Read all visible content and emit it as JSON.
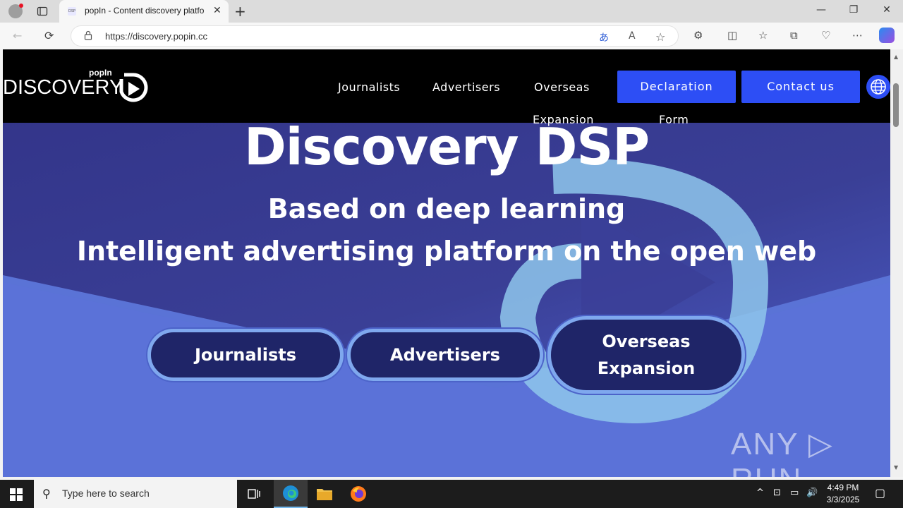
{
  "browser": {
    "tab_title": "popIn - Content discovery platfo",
    "favicon_text": "DSP",
    "url": "https://discovery.popin.cc",
    "close_glyph": "✕",
    "new_tab_glyph": "+",
    "minimize_glyph": "—",
    "restore_glyph": "❐",
    "window_close_glyph": "✕"
  },
  "site": {
    "logo_small": "popIn",
    "logo_word": "DISCOVERY",
    "nav": {
      "journalists": "Journalists",
      "advertisers": "Advertisers",
      "overseas_line1": "Overseas",
      "overseas_line2": "Expansion"
    },
    "declaration_line1": "Declaration",
    "declaration_line2": "Form",
    "contact": "Contact us"
  },
  "hero": {
    "title": "Discovery DSP",
    "subtitle1": "Based on deep learning",
    "subtitle2": "Intelligent advertising platform on the open web",
    "cta_journalists": "Journalists",
    "cta_advertisers": "Advertisers",
    "cta_overseas_line1": "Overseas",
    "cta_overseas_line2": "Expansion"
  },
  "watermark": "ANY ▷ RUN",
  "taskbar": {
    "search_placeholder": "Type here to search",
    "time": "4:49 PM",
    "date": "3/3/2025"
  },
  "colors": {
    "header_bg": "#000000",
    "button_blue": "#2d4ef5",
    "hero_bg": "#5c74d6",
    "cta_bg": "#1f2568"
  }
}
